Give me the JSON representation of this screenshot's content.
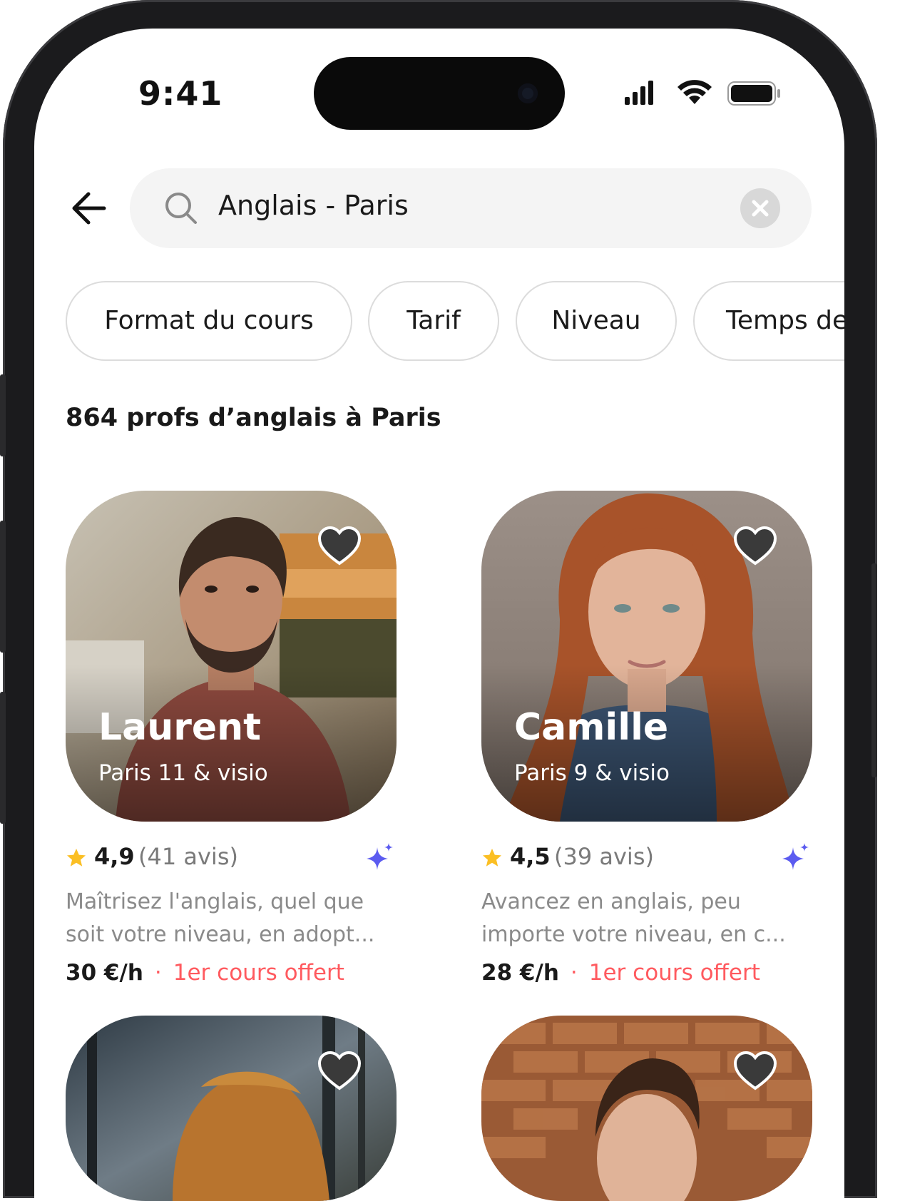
{
  "status_bar": {
    "time": "9:41"
  },
  "search": {
    "query": "Anglais - Paris"
  },
  "filters": [
    "Format du cours",
    "Tarif",
    "Niveau",
    "Temps de"
  ],
  "results_title": "864 profs d’anglais à Paris",
  "teachers": [
    {
      "name": "Laurent",
      "location": "Paris 11 & visio",
      "rating": "4,9",
      "reviews": "(41 avis)",
      "desc_line1": "Maîtrisez l'anglais, quel que",
      "desc_line2": "soit votre niveau, en adopt...",
      "price": "30 €/h",
      "offer": "1er cours offert"
    },
    {
      "name": "Camille",
      "location": "Paris 9 & visio",
      "rating": "4,5",
      "reviews": "(39 avis)",
      "desc_line1": "Avancez en anglais, peu",
      "desc_line2": "importe votre niveau, en c...",
      "price": "28 €/h",
      "offer": "1er cours offert"
    }
  ],
  "separator": "·",
  "icons": {
    "back": "arrow-left-icon",
    "search": "search-icon",
    "clear": "close-icon",
    "favorite": "heart-icon",
    "star": "star-icon",
    "sparkle": "sparkle-icon"
  },
  "colors": {
    "accent": "#ff5a5f",
    "star": "#fbbf24",
    "sparkle": "#5b5bf0"
  }
}
